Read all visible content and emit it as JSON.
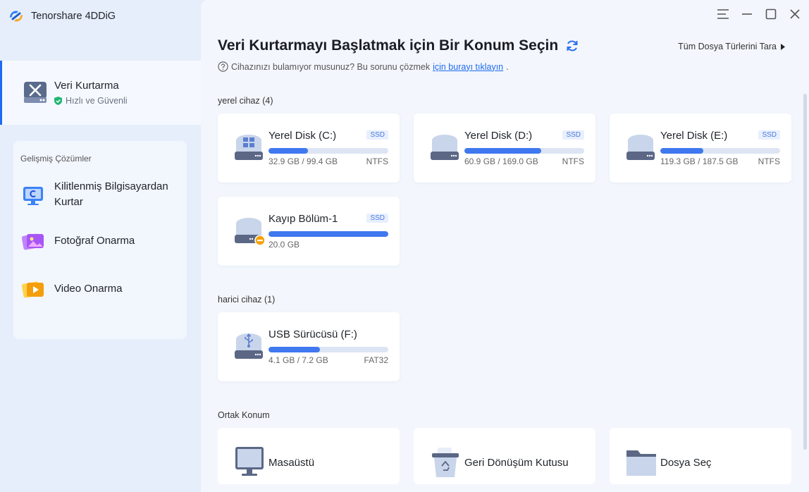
{
  "app": {
    "name": "Tenorshare 4DDiG"
  },
  "sidebar": {
    "main_item": {
      "title": "Veri Kurtarma",
      "subtitle": "Hızlı ve Güvenli"
    },
    "advanced": {
      "title": "Gelişmiş Çözümler",
      "items": [
        {
          "label": "Kilitlenmiş Bilgisayardan Kurtar",
          "icon": "locked-computer-icon"
        },
        {
          "label": "Fotoğraf Onarma",
          "icon": "photo-repair-icon"
        },
        {
          "label": "Video Onarma",
          "icon": "video-repair-icon"
        }
      ]
    }
  },
  "header": {
    "title": "Veri Kurtarmayı Başlatmak için Bir Konum Seçin",
    "scan_all": "Tüm Dosya Türlerini Tara",
    "help_text": "Cihazınızı bulamıyor musunuz? Bu sorunu çözmek",
    "help_link": "için burayı tıklayın",
    "help_end": "."
  },
  "sections": {
    "local": "yerel cihaz (4)",
    "external": "harici cihaz (1)",
    "common": "Ortak Konum"
  },
  "local_disks": [
    {
      "name": "Yerel Disk (C:)",
      "badge": "SSD",
      "size": "32.9 GB / 99.4 GB",
      "fs": "NTFS",
      "used": 0.33,
      "icon": "windows-disk-icon"
    },
    {
      "name": "Yerel Disk (D:)",
      "badge": "SSD",
      "size": "60.9 GB / 169.0 GB",
      "fs": "NTFS",
      "used": 0.64,
      "icon": "disk-icon"
    },
    {
      "name": "Yerel Disk (E:)",
      "badge": "SSD",
      "size": "119.3 GB / 187.5 GB",
      "fs": "NTFS",
      "used": 0.36,
      "icon": "disk-icon"
    },
    {
      "name": "Kayıp Bölüm-1",
      "badge": "SSD",
      "size": "20.0 GB",
      "fs": "",
      "used": 1.0,
      "icon": "lost-partition-icon"
    }
  ],
  "external_disks": [
    {
      "name": "USB Sürücüsü (F:)",
      "size": "4.1 GB / 7.2 GB",
      "fs": "FAT32",
      "used": 0.43,
      "icon": "usb-disk-icon"
    }
  ],
  "common_locations": [
    {
      "name": "Masaüstü",
      "icon": "desktop-icon"
    },
    {
      "name": "Geri Dönüşüm Kutusu",
      "icon": "recycle-bin-icon"
    },
    {
      "name": "Dosya Seç",
      "icon": "folder-icon"
    }
  ],
  "colors": {
    "accent": "#1e6bf0",
    "bar_fill": "#3f78ef",
    "bar_track": "#dde5f4",
    "sidebar_bg": "#e6eefb"
  }
}
